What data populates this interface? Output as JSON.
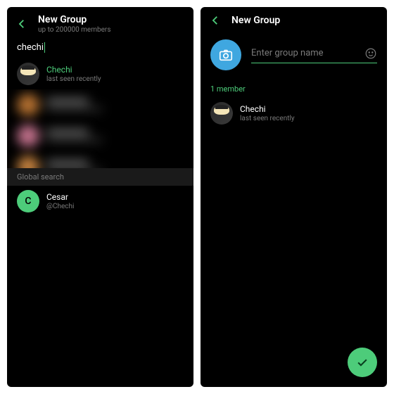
{
  "screen1": {
    "header": {
      "title": "New Group",
      "subtitle": "up to 200000 members"
    },
    "search_value": "chechi",
    "contact_top": {
      "name": "Chechi",
      "sub": "last seen recently"
    },
    "global_search_label": "Global search",
    "global_result": {
      "letter": "C",
      "name": "Cesar",
      "sub": "@Chechi"
    }
  },
  "screen2": {
    "header": {
      "title": "New Group"
    },
    "name_placeholder": "Enter group name",
    "member_count_label": "1 member",
    "member": {
      "name": "Chechi",
      "sub": "last seen recently"
    }
  }
}
